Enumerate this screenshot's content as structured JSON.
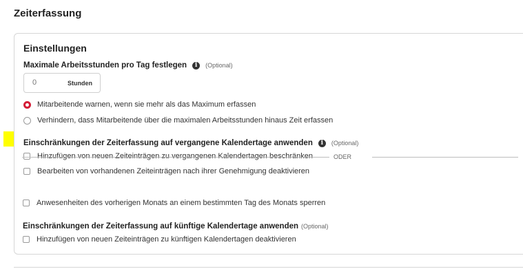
{
  "page": {
    "title": "Zeiterfassung"
  },
  "card": {
    "title": "Einstellungen"
  },
  "max_hours": {
    "label": "Maximale Arbeitsstunden pro Tag festlegen",
    "optional": "(Optional)",
    "value": "0",
    "unit": "Stunden",
    "options": [
      {
        "label": "Mitarbeitende warnen, wenn sie mehr als das Maximum erfassen",
        "selected": true
      },
      {
        "label": "Verhindern, dass Mitarbeitende über die maximalen Arbeitsstunden hinaus Zeit erfassen",
        "selected": false
      }
    ]
  },
  "past": {
    "label": "Einschränkungen der Zeiterfassung auf vergangene Kalendertage anwenden",
    "optional": "(Optional)",
    "options": [
      {
        "label": "Hinzufügen von neuen Zeiteinträgen zu vergangenen Kalendertagen beschränken",
        "checked": false
      },
      {
        "label": "Bearbeiten von vorhandenen Zeiteinträgen nach ihrer Genehmigung deaktivieren",
        "checked": false
      }
    ],
    "or_label": "ODER",
    "month_lock": {
      "label": "Anwesenheiten des vorherigen Monats an einem bestimmten Tag des Monats sperren",
      "checked": false
    }
  },
  "future": {
    "label": "Einschränkungen der Zeiterfassung auf künftige Kalendertage anwenden",
    "optional": "(Optional)",
    "options": [
      {
        "label": "Hinzufügen von neuen Zeiteinträgen zu künftigen Kalendertagen deaktivieren",
        "checked": false
      }
    ]
  },
  "colors": {
    "accent": "#d41c36",
    "highlight": "#ffff00",
    "border": "#d6d6d6"
  },
  "icons": {
    "info": "info-icon"
  }
}
